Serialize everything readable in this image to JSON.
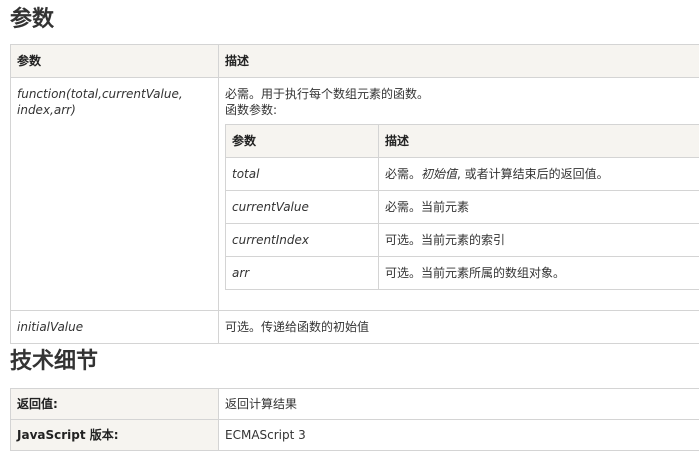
{
  "sections": {
    "params_title": "参数",
    "tech_title": "技术细节"
  },
  "params_table": {
    "header": [
      "参数",
      "描述"
    ],
    "function_row": {
      "name": "function(total,currentValue, index,arr)",
      "desc_line1": "必需。用于执行每个数组元素的函数。",
      "desc_line2": "函数参数:",
      "nested_header": [
        "参数",
        "描述"
      ],
      "nested_rows": [
        {
          "name": "total",
          "desc_prefix": "必需。",
          "desc_italic": "初始值",
          "desc_suffix": ", 或者计算结束后的返回值。"
        },
        {
          "name": "currentValue",
          "desc": "必需。当前元素"
        },
        {
          "name": "currentIndex",
          "desc": "可选。当前元素的索引"
        },
        {
          "name": "arr",
          "desc": "可选。当前元素所属的数组对象。"
        }
      ]
    },
    "initial_row": {
      "name": "initialValue",
      "desc": "可选。传递给函数的初始值"
    }
  },
  "tech_table": {
    "rows": [
      {
        "label": "返回值:",
        "value": "返回计算结果"
      },
      {
        "label": "JavaScript 版本:",
        "value": "ECMAScript 3"
      }
    ]
  }
}
